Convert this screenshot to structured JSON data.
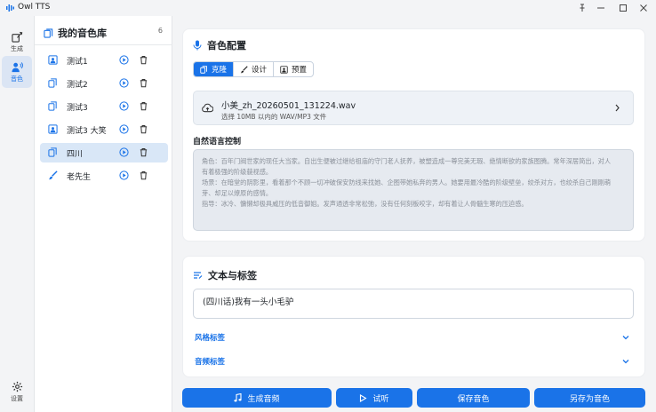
{
  "window": {
    "title": "Owl TTS",
    "controls": [
      "pin",
      "minimize",
      "maximize",
      "close"
    ]
  },
  "rail": {
    "items": [
      {
        "label": "生成",
        "icon": "generate-icon",
        "active": false
      },
      {
        "label": "音色",
        "icon": "voice-icon",
        "active": true
      }
    ],
    "settings_label": "设置"
  },
  "library": {
    "title": "我的音色库",
    "count": "6",
    "items": [
      {
        "name": "测试1",
        "type": "preset-icon",
        "selected": false
      },
      {
        "name": "测试2",
        "type": "clone-icon",
        "selected": false
      },
      {
        "name": "测试3",
        "type": "clone-icon",
        "selected": false
      },
      {
        "name": "测试3 大笑",
        "type": "preset-icon",
        "selected": false
      },
      {
        "name": "四川",
        "type": "clone-icon",
        "selected": true
      },
      {
        "name": "老先生",
        "type": "design-icon",
        "selected": false
      }
    ]
  },
  "voice_config": {
    "title": "音色配置",
    "tabs": [
      {
        "label": "克隆",
        "active": true
      },
      {
        "label": "设计",
        "active": false
      },
      {
        "label": "预置",
        "active": false
      }
    ],
    "file": {
      "name": "小美_zh_20260501_131224.wav",
      "hint": "选择 10MB 以内的 WAV/MP3 文件"
    },
    "nl_label": "自然语言控制",
    "nl_lines": [
      "角色：百年门阀世家的现任大当家。自出生便被过继给祖庙的守门老人抚养，被塑造成一尊完美无瑕、绝情断欲的家族图腾。常年深居简出，对人",
      "有着极强的阶级藐视感。",
      "场景：在暗堂的阴影里，看着那个不顾一切冲破保安防线来找她、企图带她私奔的男人。她要用最冷酷的阶级壁垒，绞杀对方，也绞杀自己刚刚萌",
      "芽、却足以燎原的感情。",
      "指导：冰冷、慵懒却极具威压的低音御姐。发声通透非常松弛，没有任何刻板咬字，却有着让人骨髓生寒的压迫感。"
    ]
  },
  "text_tags": {
    "title": "文本与标签",
    "text_value": "(四川话)我有一头小毛驴",
    "style_tags_label": "风格标签",
    "audio_tags_label": "音频标签"
  },
  "actions": {
    "generate": "生成音频",
    "listen": "试听",
    "save": "保存音色",
    "save_as": "另存为音色"
  },
  "colors": {
    "accent": "#1a73e8",
    "selected_bg": "#d9e7f7",
    "rail_active_bg": "#dbe5f4"
  }
}
